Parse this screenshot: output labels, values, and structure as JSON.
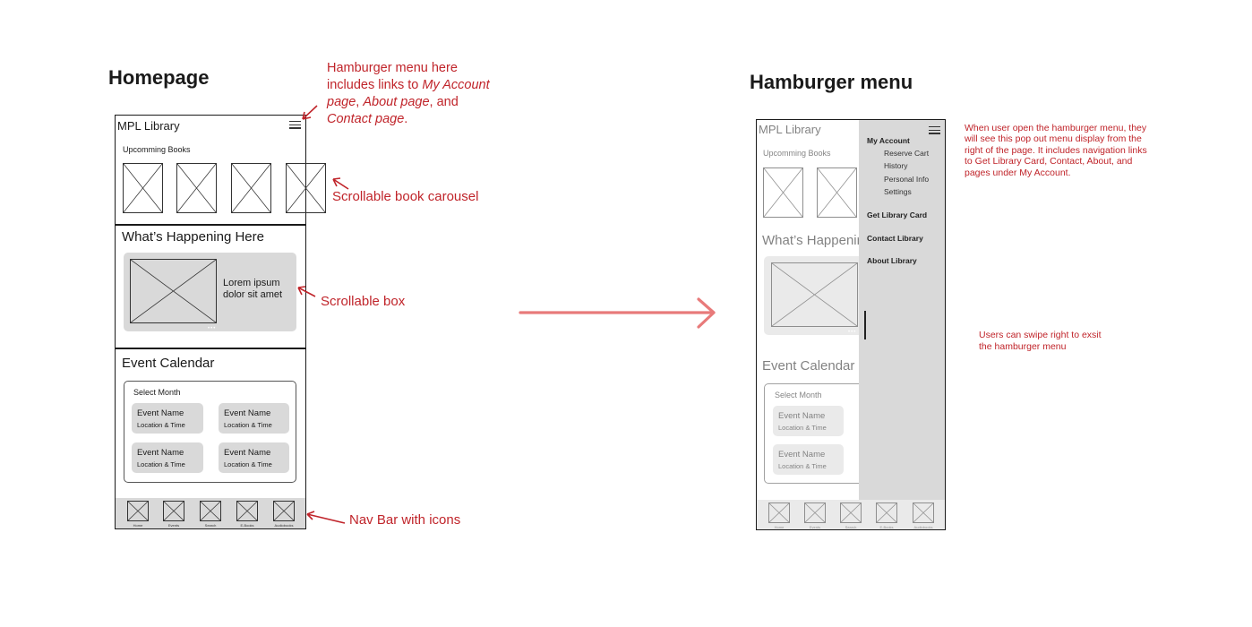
{
  "left": {
    "heading": "Homepage",
    "app_title": "MPL Library",
    "upcoming_label": "Upcomming Books",
    "happening_title": "What’s Happening Here",
    "happening_text_1": "Lorem ipsum",
    "happening_text_2": "dolor sit amet",
    "calendar_title": "Event Calendar",
    "select_month": "Select Month",
    "events": [
      {
        "name": "Event Name",
        "loc": "Location & Time"
      },
      {
        "name": "Event Name",
        "loc": "Location & Time"
      },
      {
        "name": "Event Name",
        "loc": "Location & Time"
      },
      {
        "name": "Event Name",
        "loc": "Location & Time"
      }
    ],
    "nav": [
      "Home",
      "Events",
      "Search",
      "E-Books",
      "Audiobooks"
    ]
  },
  "annotations": {
    "hamburger_1": "Hamburger menu here",
    "hamburger_2": "includes links to",
    "hamburger_2i": "My Account",
    "hamburger_3i": "page",
    "hamburger_3": ", ",
    "hamburger_3i2": "About page",
    "hamburger_3b": ", and",
    "hamburger_4i": "Contact page",
    "hamburger_4": ".",
    "carousel": "Scrollable book carousel",
    "box": "Scrollable box",
    "navbar": "Nav Bar with icons"
  },
  "right": {
    "heading": "Hamburger menu",
    "app_title": "MPL Library",
    "upcoming_label": "Upcomming Books",
    "happening_title": "What’s Happening Here",
    "calendar_title": "Event Calendar",
    "select_month": "Select Month",
    "events": [
      {
        "name": "Event Name",
        "loc": "Location & Time"
      },
      {
        "name": "Event Name",
        "loc": "Location & Time"
      }
    ],
    "nav": [
      "Home",
      "Events",
      "Search",
      "E-Books",
      "Audiobooks"
    ],
    "menu": {
      "my_account": "My Account",
      "sub": [
        "Reserve Cart",
        "History",
        "Personal Info",
        "Settings"
      ],
      "get_card": "Get Library Card",
      "contact": "Contact Library",
      "about": "About Library"
    },
    "note_menu": "When user open the hamburger menu, they will see this pop out menu display from the right of the page. It includes navigation links to Get Library Card, Contact, About, and pages under My Account.",
    "note_swipe_1": "Users can swipe right to exsit",
    "note_swipe_2": "the hamburger menu"
  },
  "colors": {
    "annotation_red": "#c0242a",
    "arrow_pink": "#e87a7a",
    "panel_gray": "#d9d9d9"
  }
}
